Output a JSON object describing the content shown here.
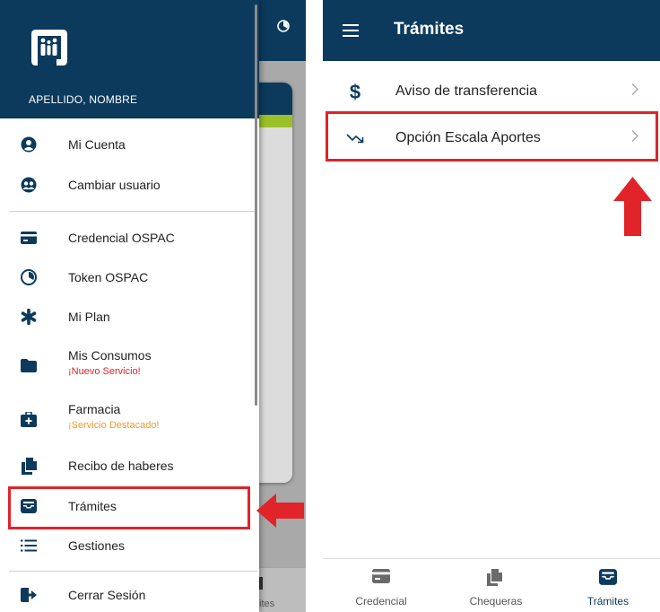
{
  "left_panel": {
    "user_name": "APELLIDO, NOMBRE",
    "background": {
      "partial_nav_label": "ites"
    },
    "menu": [
      {
        "label": "Mi Cuenta",
        "icon": "account-circle-icon"
      },
      {
        "label": "Cambiar usuario",
        "icon": "switch-user-icon"
      },
      {
        "label": "Credencial OSPAC",
        "icon": "credit-card-icon"
      },
      {
        "label": "Token OSPAC",
        "icon": "timer-icon"
      },
      {
        "label": "Mi Plan",
        "icon": "asterisk-icon"
      },
      {
        "label": "Mis Consumos",
        "sub": "¡Nuevo Servicio!",
        "sub_color": "#e0242a",
        "icon": "folder-icon"
      },
      {
        "label": "Farmacia",
        "sub": "¡Servicio Destacado!",
        "sub_color": "#f39a2b",
        "icon": "medical-kit-icon"
      },
      {
        "label": "Recibo de haberes",
        "icon": "documents-icon"
      },
      {
        "label": "Trámites",
        "icon": "inbox-tray-icon",
        "highlighted": true
      },
      {
        "label": "Gestiones",
        "icon": "list-icon"
      },
      {
        "label": "Cerrar Sesión",
        "icon": "logout-icon"
      }
    ]
  },
  "right_panel": {
    "title": "Trámites",
    "rows": [
      {
        "label": "Aviso de transferencia",
        "icon": "dollar-icon"
      },
      {
        "label": "Opción Escala Aportes",
        "icon": "trending-down-icon",
        "highlighted": true
      }
    ],
    "bottom_nav": [
      {
        "label": "Credencial",
        "icon": "credit-card-icon",
        "active": false
      },
      {
        "label": "Chequeras",
        "icon": "documents-icon",
        "active": false
      },
      {
        "label": "Trámites",
        "icon": "inbox-tray-icon",
        "active": true
      }
    ]
  },
  "colors": {
    "primary": "#0c3a5c",
    "highlight_red": "#e0242a",
    "accent_green": "#9ac128",
    "orange": "#f39a2b"
  }
}
